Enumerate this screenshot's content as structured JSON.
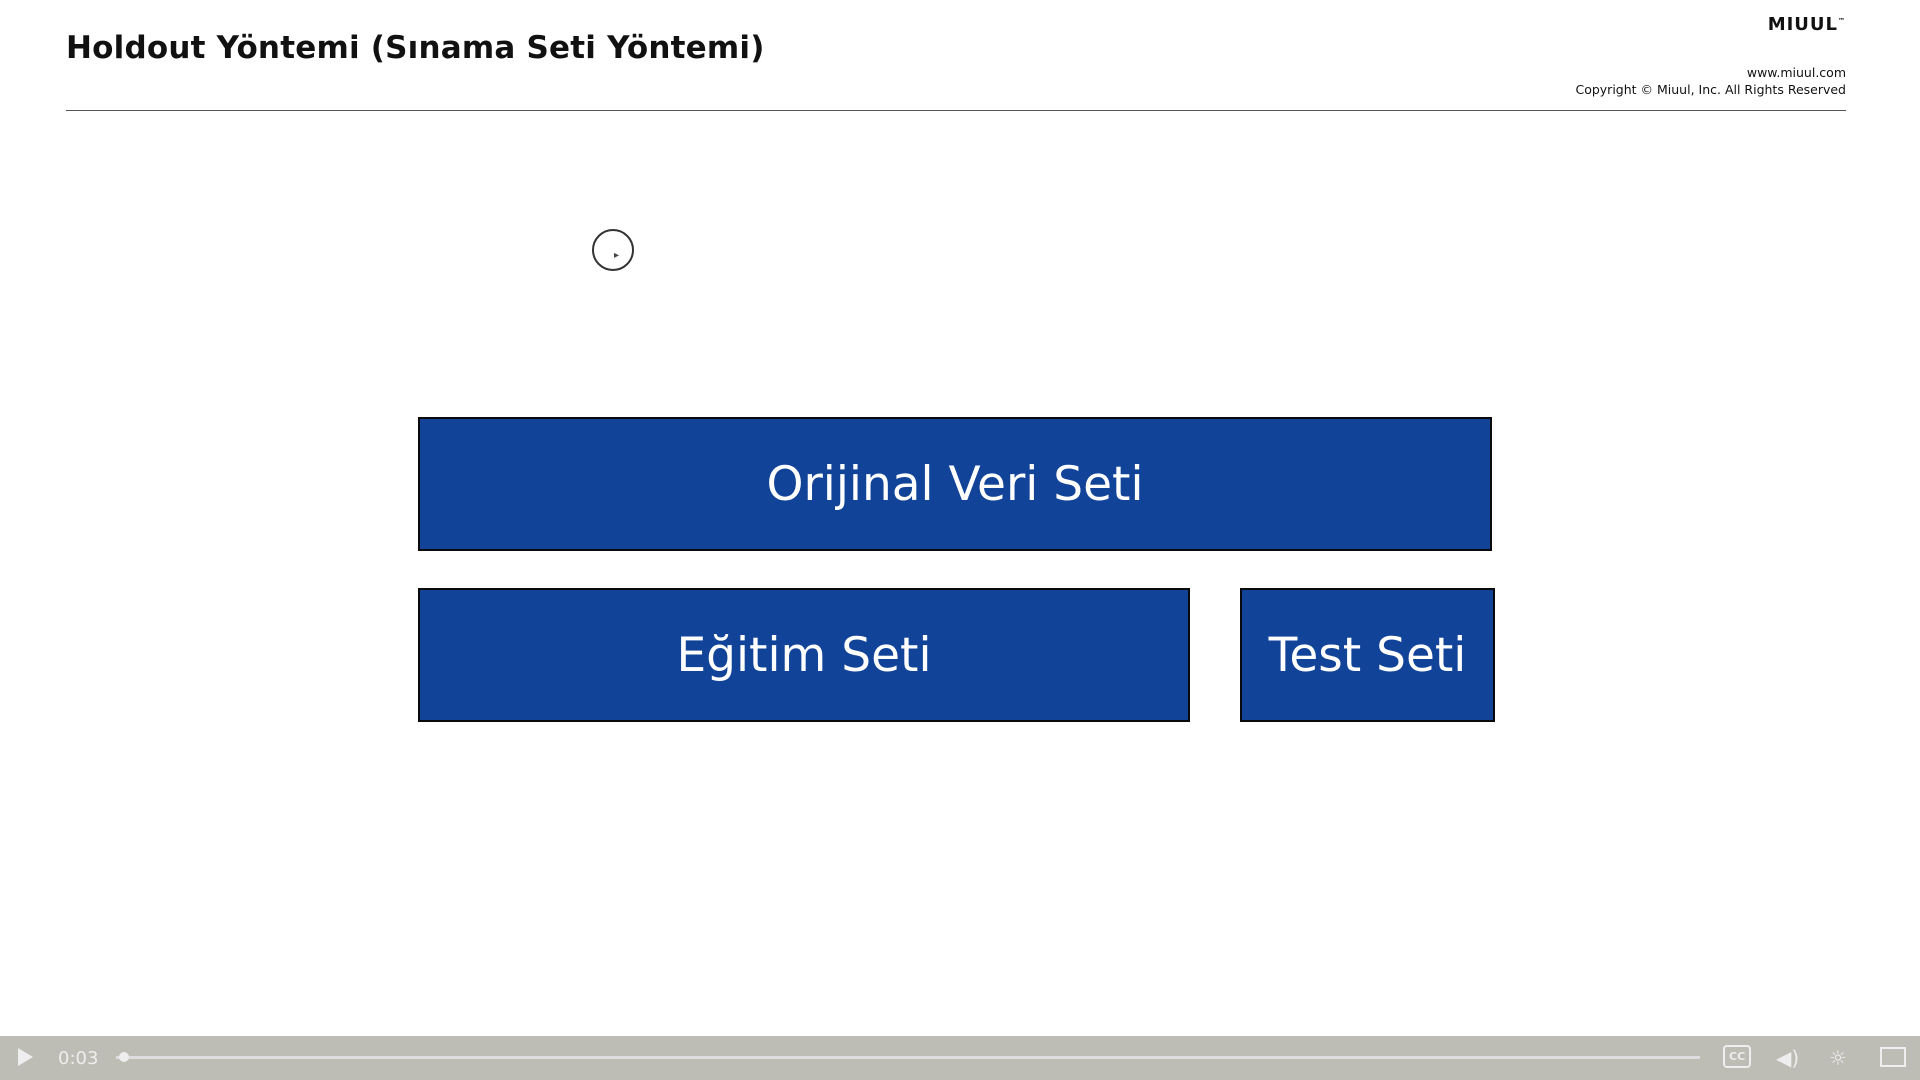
{
  "header": {
    "title": "Holdout Yöntemi (Sınama Seti Yöntemi)",
    "logo": "MIUUL",
    "trademark": "™",
    "website": "www.miuul.com",
    "copyright": "Copyright © Miuul, Inc. All Rights Reserved"
  },
  "diagram": {
    "original": "Orijinal Veri Seti",
    "train": "Eğitim Seti",
    "test": "Test Seti"
  },
  "player": {
    "time": "0:03",
    "progress": 0.002,
    "cc": "CC"
  }
}
